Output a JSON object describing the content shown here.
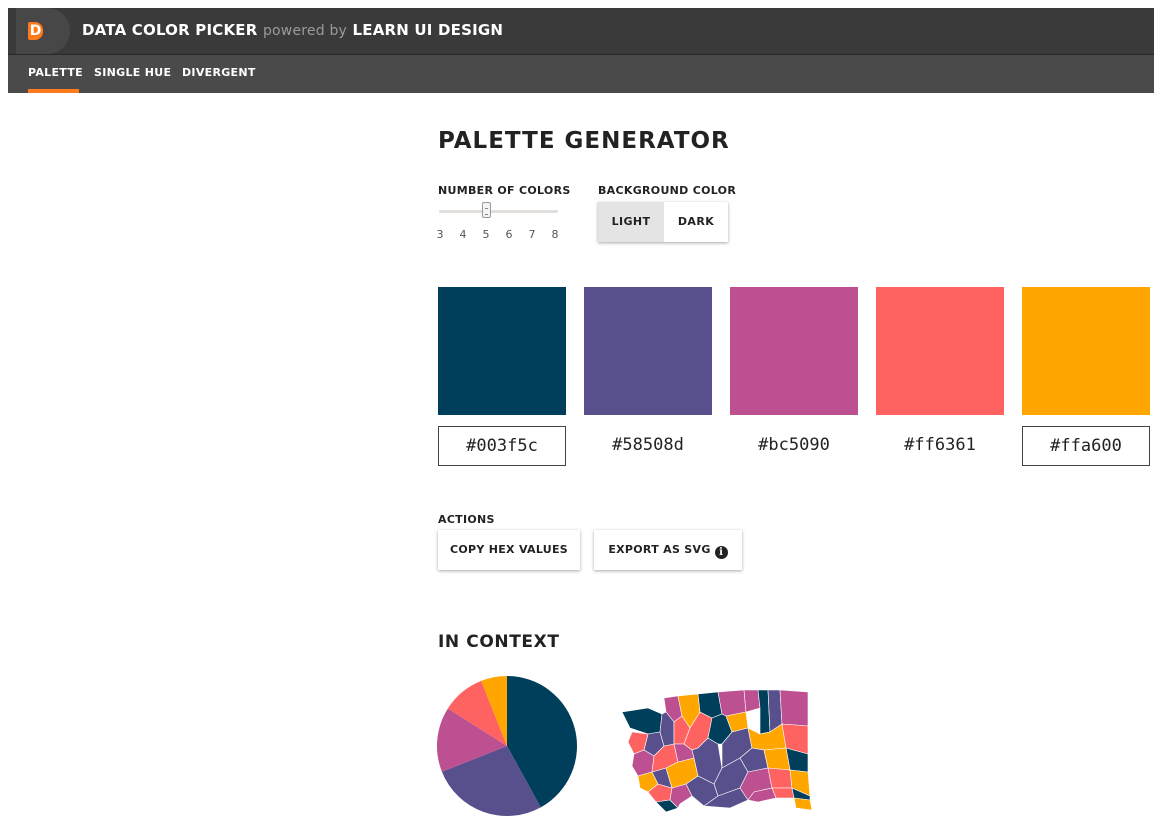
{
  "header": {
    "logo_letter": "D",
    "app_title": "DATA COLOR PICKER",
    "powered_by": "powered by",
    "brand": "LEARN UI DESIGN"
  },
  "nav": {
    "tabs": [
      {
        "label": "PALETTE",
        "active": true
      },
      {
        "label": "SINGLE HUE"
      },
      {
        "label": "DIVERGENT"
      }
    ]
  },
  "main": {
    "title": "PALETTE GENERATOR",
    "number_of_colors": {
      "label": "NUMBER OF COLORS",
      "ticks": [
        "3",
        "4",
        "5",
        "6",
        "7",
        "8"
      ],
      "value": 5
    },
    "background_color": {
      "label": "BACKGROUND COLOR",
      "options": [
        "LIGHT",
        "DARK"
      ],
      "selected": "LIGHT"
    },
    "palette": [
      {
        "hex": "#003f5c"
      },
      {
        "hex": "#58508d"
      },
      {
        "hex": "#bc5090"
      },
      {
        "hex": "#ff6361"
      },
      {
        "hex": "#ffa600"
      }
    ],
    "actions": {
      "label": "ACTIONS",
      "copy_label": "COPY HEX VALUES",
      "export_label": "EXPORT AS SVG",
      "info_glyph": "i"
    },
    "in_context": {
      "title": "IN CONTEXT",
      "pie_values": [
        42,
        27,
        15,
        10,
        6
      ]
    }
  },
  "colors": {
    "accent": "#ff7a1a",
    "header_bg": "#3a3a3a",
    "nav_bg": "#4a4a4a"
  }
}
